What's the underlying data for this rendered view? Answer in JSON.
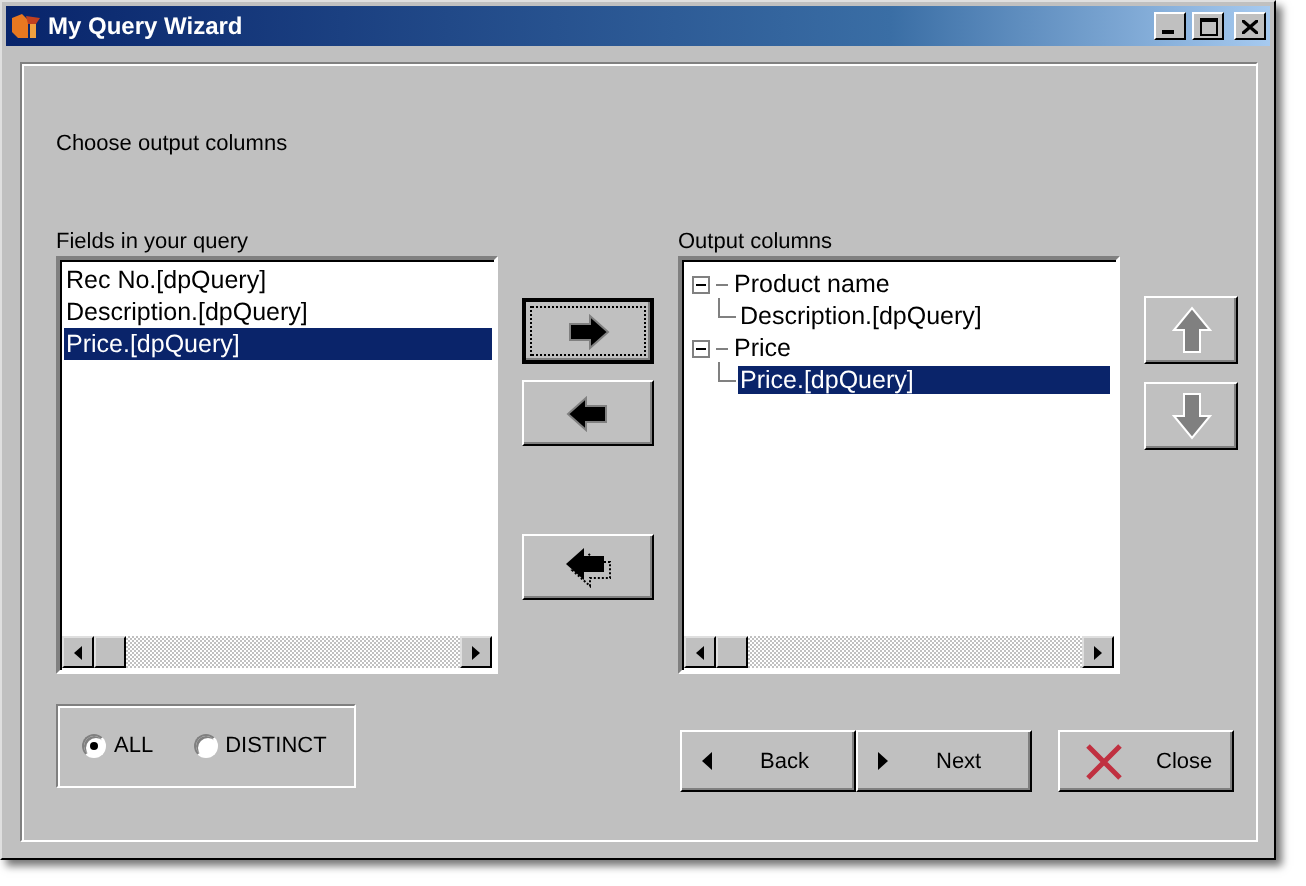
{
  "window": {
    "title": "My Query Wizard"
  },
  "instruction": "Choose output columns",
  "fields": {
    "label": "Fields in your query",
    "items": [
      {
        "text": "Rec No.[dpQuery]",
        "selected": false
      },
      {
        "text": "Description.[dpQuery]",
        "selected": false
      },
      {
        "text": "Price.[dpQuery]",
        "selected": true
      }
    ]
  },
  "transfer_buttons": [
    {
      "kind": "add",
      "focused": true
    },
    {
      "kind": "remove",
      "focused": false
    },
    {
      "kind": "remove_all",
      "focused": false
    }
  ],
  "output": {
    "label": "Output columns",
    "tree": [
      {
        "text": "Product name",
        "expanded": true,
        "selected": false,
        "children": [
          {
            "text": "Description.[dpQuery]",
            "selected": false
          }
        ]
      },
      {
        "text": "Price",
        "expanded": true,
        "selected": false,
        "children": [
          {
            "text": "Price.[dpQuery]",
            "selected": true
          }
        ]
      }
    ]
  },
  "order_buttons": [
    {
      "kind": "up",
      "disabled": true
    },
    {
      "kind": "down",
      "disabled": true
    }
  ],
  "mode": [
    {
      "label": "ALL",
      "selected": true
    },
    {
      "label": "DISTINCT",
      "selected": false
    }
  ],
  "buttons": [
    {
      "kind": "back",
      "label": "Back"
    },
    {
      "kind": "next",
      "label": "Next"
    },
    {
      "kind": "close",
      "label": "Close"
    }
  ]
}
